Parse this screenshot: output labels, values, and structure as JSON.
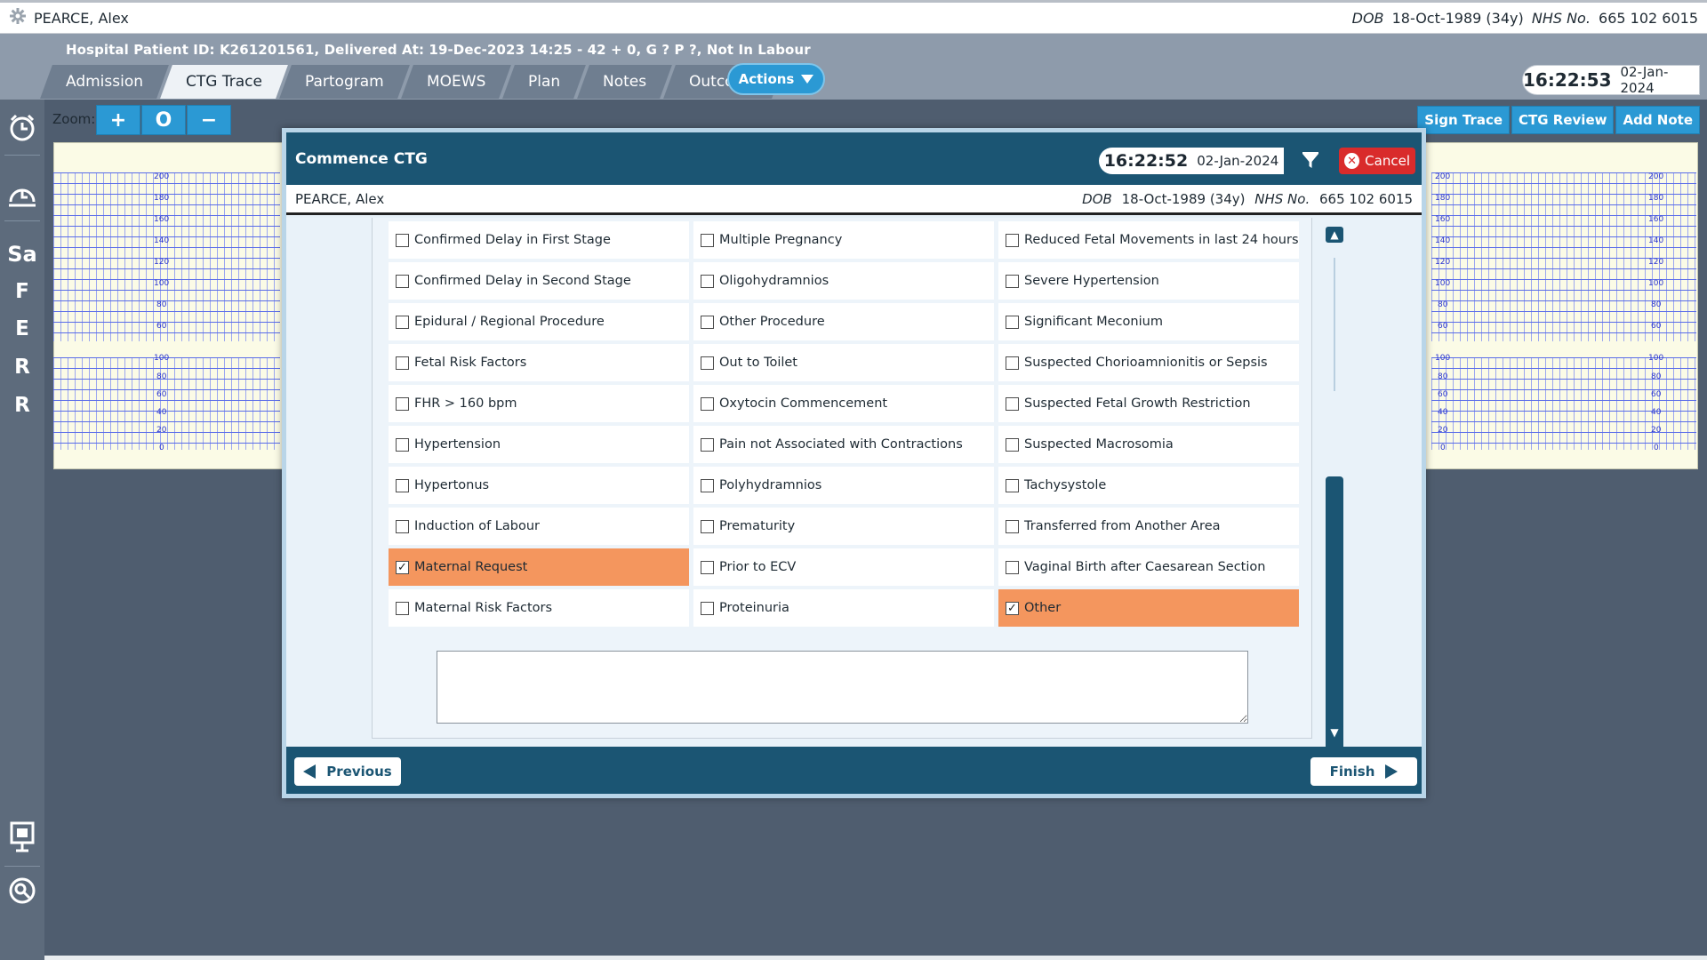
{
  "patient": {
    "name": "PEARCE, Alex",
    "dob_label": "DOB",
    "dob": "18-Oct-1989 (34y)",
    "nhs_label": "NHS No.",
    "nhs": "665 102 6015"
  },
  "header": {
    "hospital_line": "Hospital Patient ID: K261201561, Delivered At: 19-Dec-2023 14:25 - 42 + 0, G ? P ?,   Not In Labour",
    "tabs": [
      "Admission",
      "CTG Trace",
      "Partogram",
      "MOEWS",
      "Plan",
      "Notes",
      "Outcome"
    ],
    "active_tab": "CTG Trace",
    "actions_label": "Actions",
    "clock_time": "16:22:53",
    "clock_date": "02-Jan-2024"
  },
  "sidebar": {
    "items": [
      "Sa",
      "F",
      "E",
      "R",
      "R"
    ]
  },
  "toolbar": {
    "zoom_label": "Zoom:",
    "zoom_in": "+",
    "zoom_reset": "O",
    "zoom_out": "−",
    "sign_trace": "Sign Trace",
    "ctg_review": "CTG Review",
    "add_note": "Add Note"
  },
  "ctg": {
    "fhr_ticks": [
      "200",
      "180",
      "160",
      "140",
      "120",
      "100",
      "80",
      "60"
    ],
    "toco_ticks": [
      "100",
      "80",
      "60",
      "40",
      "20",
      "0"
    ]
  },
  "modal": {
    "title": "Commence CTG",
    "time": "16:22:52",
    "date": "02-Jan-2024",
    "cancel_label": "Cancel",
    "previous_label": "Previous",
    "finish_label": "Finish",
    "notes_value": "",
    "options": {
      "col1": [
        {
          "label": "Confirmed Delay in First Stage",
          "checked": false
        },
        {
          "label": "Confirmed Delay in Second Stage",
          "checked": false
        },
        {
          "label": "Epidural / Regional Procedure",
          "checked": false
        },
        {
          "label": "Fetal Risk Factors",
          "checked": false
        },
        {
          "label": "FHR > 160 bpm",
          "checked": false
        },
        {
          "label": "Hypertension",
          "checked": false
        },
        {
          "label": "Hypertonus",
          "checked": false
        },
        {
          "label": "Induction of Labour",
          "checked": false
        },
        {
          "label": "Maternal Request",
          "checked": true
        },
        {
          "label": "Maternal Risk Factors",
          "checked": false
        }
      ],
      "col2": [
        {
          "label": "Multiple Pregnancy",
          "checked": false
        },
        {
          "label": "Oligohydramnios",
          "checked": false
        },
        {
          "label": "Other Procedure",
          "checked": false
        },
        {
          "label": "Out to Toilet",
          "checked": false
        },
        {
          "label": "Oxytocin Commencement",
          "checked": false
        },
        {
          "label": "Pain not Associated with Contractions",
          "checked": false
        },
        {
          "label": "Polyhydramnios",
          "checked": false
        },
        {
          "label": "Prematurity",
          "checked": false
        },
        {
          "label": "Prior to ECV",
          "checked": false
        },
        {
          "label": "Proteinuria",
          "checked": false
        }
      ],
      "col3": [
        {
          "label": "Reduced Fetal Movements in last 24 hours",
          "checked": false
        },
        {
          "label": "Severe Hypertension",
          "checked": false
        },
        {
          "label": "Significant Meconium",
          "checked": false
        },
        {
          "label": "Suspected Chorioamnionitis or Sepsis",
          "checked": false
        },
        {
          "label": "Suspected Fetal Growth Restriction",
          "checked": false
        },
        {
          "label": "Suspected Macrosomia",
          "checked": false
        },
        {
          "label": "Tachysystole",
          "checked": false
        },
        {
          "label": "Transferred from Another Area",
          "checked": false
        },
        {
          "label": "Vaginal Birth after Caesarean Section",
          "checked": false
        },
        {
          "label": "Other",
          "checked": true
        }
      ]
    }
  },
  "colors": {
    "accent": "#2b99d4",
    "modal_header": "#1b5573",
    "checked_option": "#f4965e",
    "cancel": "#d92b2b"
  }
}
